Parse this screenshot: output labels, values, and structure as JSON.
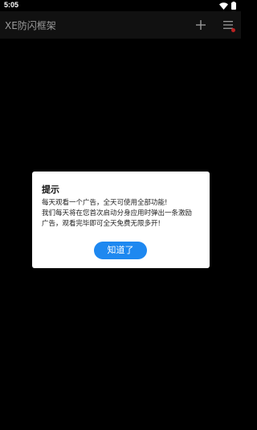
{
  "status_bar": {
    "time": "5:05"
  },
  "app_bar": {
    "title": "XE防闪框架",
    "add_icon": "plus-icon",
    "menu_icon": "hamburger-menu-icon"
  },
  "dialog": {
    "title": "提示",
    "message_lines": [
      "每天观看一个广告，全天可使用全部功能!",
      "我们每天将在您首次启动分身应用时弹出一条激励",
      "广告，观看完毕即可全天免费无限多开!"
    ],
    "confirm_label": "知道了",
    "accent_color": "#1e88f0"
  }
}
